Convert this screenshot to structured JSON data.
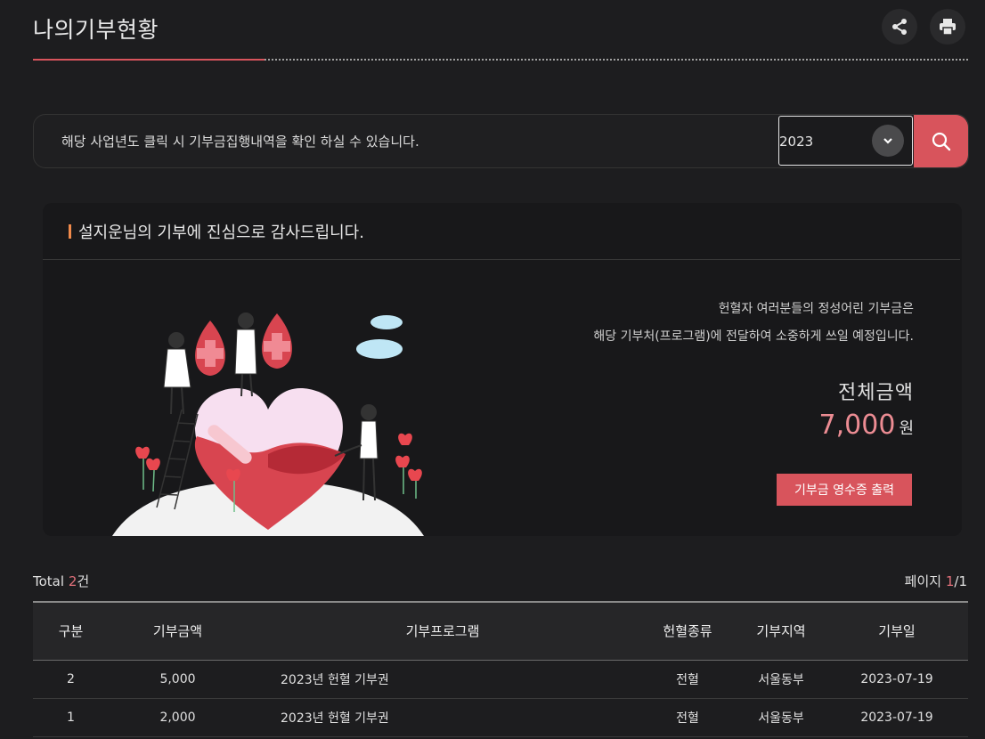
{
  "page": {
    "title": "나의기부현황"
  },
  "toolbar": {
    "share_icon": "share-icon",
    "print_icon": "print-icon"
  },
  "search": {
    "notice": "해당 사업년도 클릭 시 기부금집행내역을 확인 하실 수 있습니다.",
    "year_value": "2023",
    "search_icon": "search-icon"
  },
  "card": {
    "heading": "설지운님의 기부에 진심으로 감사드립니다.",
    "message_line1": "헌혈자 여러분들의 정성어린 기부금은",
    "message_line2": "해당 기부처(프로그램)에 전달하여 소중하게 쓰일 예정입니다.",
    "total_label": "전체금액",
    "total_amount": "7,000",
    "currency": "원",
    "receipt_button": "기부금 영수증 출력"
  },
  "list_meta": {
    "total_prefix": "Total ",
    "total_count": "2",
    "total_suffix": "건",
    "page_prefix": "페이지 ",
    "page_current": "1",
    "page_sep": "/",
    "page_total": "1"
  },
  "table": {
    "columns": [
      "구분",
      "기부금액",
      "기부프로그램",
      "헌혈종류",
      "기부지역",
      "기부일"
    ],
    "rows": [
      [
        "2",
        "5,000",
        "2023년 헌혈 기부권",
        "전혈",
        "서울동부",
        "2023-07-19"
      ],
      [
        "1",
        "2,000",
        "2023년 헌혈 기부권",
        "전혈",
        "서울동부",
        "2023-07-19"
      ]
    ]
  },
  "colors": {
    "accent": "#d8545c",
    "amount": "#ec8c93",
    "heading_bar": "#f08a4b"
  }
}
